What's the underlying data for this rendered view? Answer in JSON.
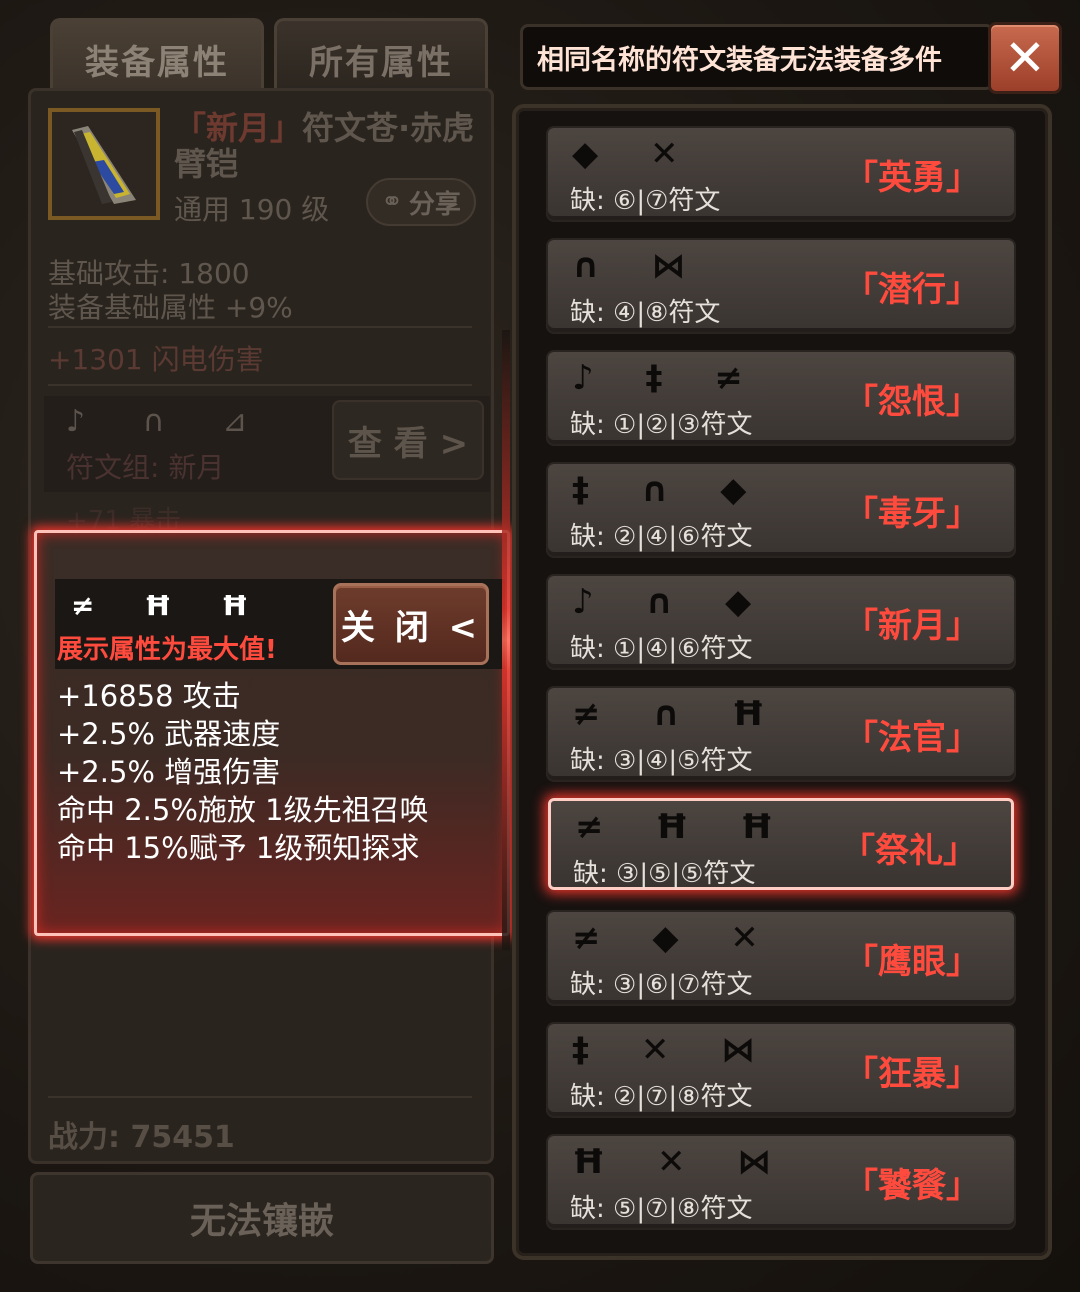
{
  "tabs": {
    "equip": "装备属性",
    "all": "所有属性"
  },
  "item": {
    "name_red": "「新月」",
    "name_grey": "符文苍·赤虎臂铠",
    "level": "通用 190 级",
    "share": "分享",
    "base_attack": "基础攻击:  1800",
    "base_attr": "装备基础属性 +9%",
    "lightning": "+1301 闪电伤害",
    "rune_glyphs": "♪ ∩ ⊿",
    "rune_group": "符文组: 新月",
    "view": "查 看 >",
    "faded_line": "+71 暴击",
    "power": "战力: 75451",
    "inlay": "无法镶嵌"
  },
  "popup": {
    "runes": "≠ Ħ Ħ",
    "note": "展示属性为最大值!",
    "close": "关 闭 <",
    "stats": [
      "+16858 攻击",
      "+2.5% 武器速度",
      "+2.5% 增强伤害",
      "命中 2.5%施放 1级先祖召唤",
      "命中 15%赋予 1级预知探求"
    ]
  },
  "title_bar": "相同名称的符文装备无法装备多件",
  "close_x": "✕",
  "sets": [
    {
      "glyphs": "◆ ✕",
      "missing": "缺:  ⑥|⑦符文",
      "name": "「英勇」"
    },
    {
      "glyphs": "∩ ⋈",
      "missing": "缺:  ④|⑧符文",
      "name": "「潜行」"
    },
    {
      "glyphs": "♪ ‡ ≠",
      "missing": "缺:  ①|②|③符文",
      "name": "「怨恨」"
    },
    {
      "glyphs": "‡ ∩ ◆",
      "missing": "缺:  ②|④|⑥符文",
      "name": "「毒牙」"
    },
    {
      "glyphs": "♪ ∩ ◆",
      "missing": "缺:  ①|④|⑥符文",
      "name": "「新月」"
    },
    {
      "glyphs": "≠ ∩ Ħ",
      "missing": "缺:  ③|④|⑤符文",
      "name": "「法官」"
    },
    {
      "glyphs": "≠ Ħ Ħ",
      "missing": "缺:  ③|⑤|⑤符文",
      "name": "「祭礼」",
      "selected": true
    },
    {
      "glyphs": "≠ ◆ ✕",
      "missing": "缺:  ③|⑥|⑦符文",
      "name": "「鹰眼」"
    },
    {
      "glyphs": "‡ ✕ ⋈",
      "missing": "缺:  ②|⑦|⑧符文",
      "name": "「狂暴」"
    },
    {
      "glyphs": "Ħ ✕ ⋈",
      "missing": "缺:  ⑤|⑦|⑧符文",
      "name": "「饕餮」"
    }
  ]
}
